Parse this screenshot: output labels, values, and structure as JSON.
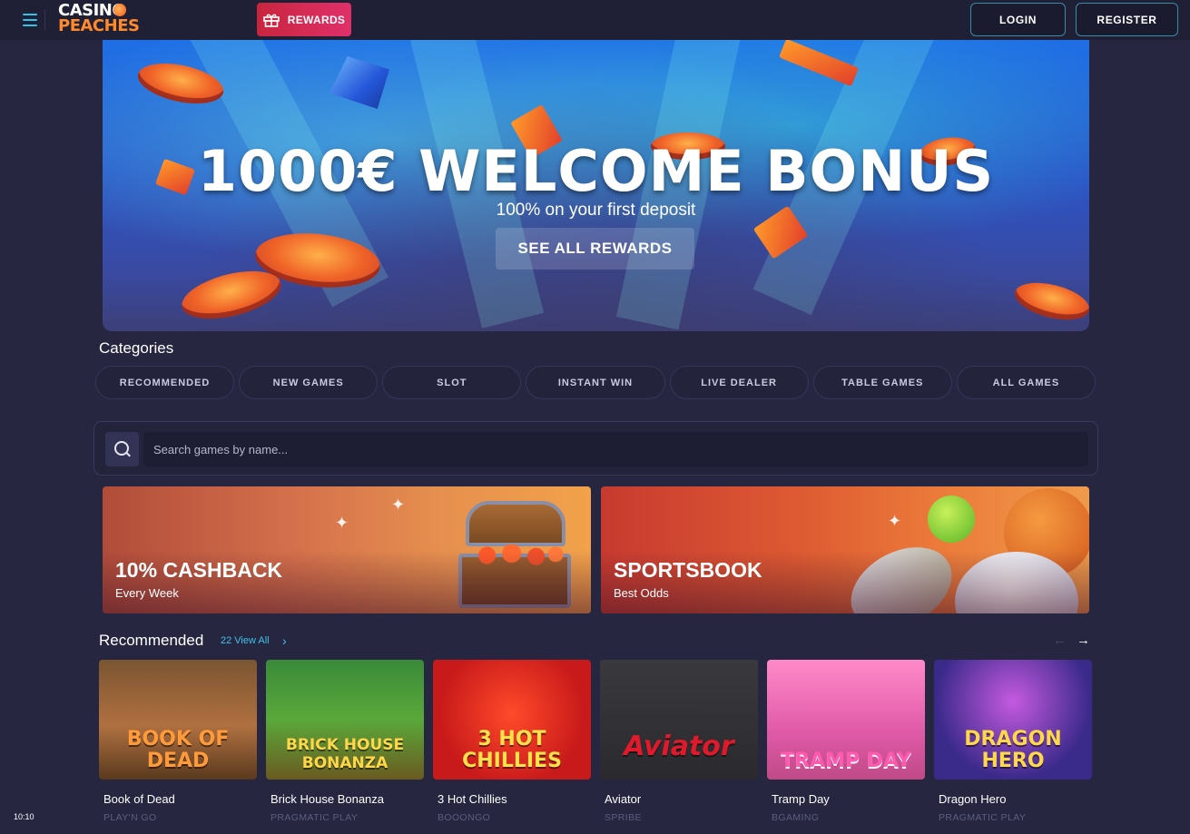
{
  "header": {
    "logo_line1": "CASINO",
    "logo_line2": "PEACHES",
    "rewards_label": "REWARDS",
    "login_label": "LOGIN",
    "register_label": "REGISTER"
  },
  "hero": {
    "title": "1000€ WELCOME BONUS",
    "subtitle": "100% on your first deposit",
    "cta_label": "SEE ALL REWARDS"
  },
  "categories": {
    "title": "Categories",
    "items": [
      "RECOMMENDED",
      "NEW GAMES",
      "SLOT",
      "INSTANT WIN",
      "LIVE DEALER",
      "TABLE GAMES",
      "ALL GAMES"
    ]
  },
  "search": {
    "placeholder": "Search games by name..."
  },
  "promos": [
    {
      "title": "10% CASHBACK",
      "subtitle": "Every Week"
    },
    {
      "title": "SPORTSBOOK",
      "subtitle": "Best Odds"
    }
  ],
  "recommended": {
    "title": "Recommended",
    "view_all": "22 View All",
    "games": [
      {
        "name": "Book of Dead",
        "provider": "PLAY'N GO",
        "art": "BOOK OF DEAD"
      },
      {
        "name": "Brick House Bonanza",
        "provider": "PRAGMATIC PLAY",
        "art": "BRICK HOUSE BONANZA"
      },
      {
        "name": "3 Hot Chillies",
        "provider": "BOOONGO",
        "art": "3 HOT CHILLIES"
      },
      {
        "name": "Aviator",
        "provider": "SPRIBE",
        "art": "Aviator"
      },
      {
        "name": "Tramp Day",
        "provider": "BGAMING",
        "art": "TRAMP DAY"
      },
      {
        "name": "Dragon Hero",
        "provider": "PRAGMATIC PLAY",
        "art": "DRAGON HERO"
      }
    ]
  },
  "system": {
    "clock": "10:10"
  },
  "colors": {
    "background": "#262640",
    "accent_cyan": "#3fc3ea",
    "rewards_red": "#c9253e"
  }
}
